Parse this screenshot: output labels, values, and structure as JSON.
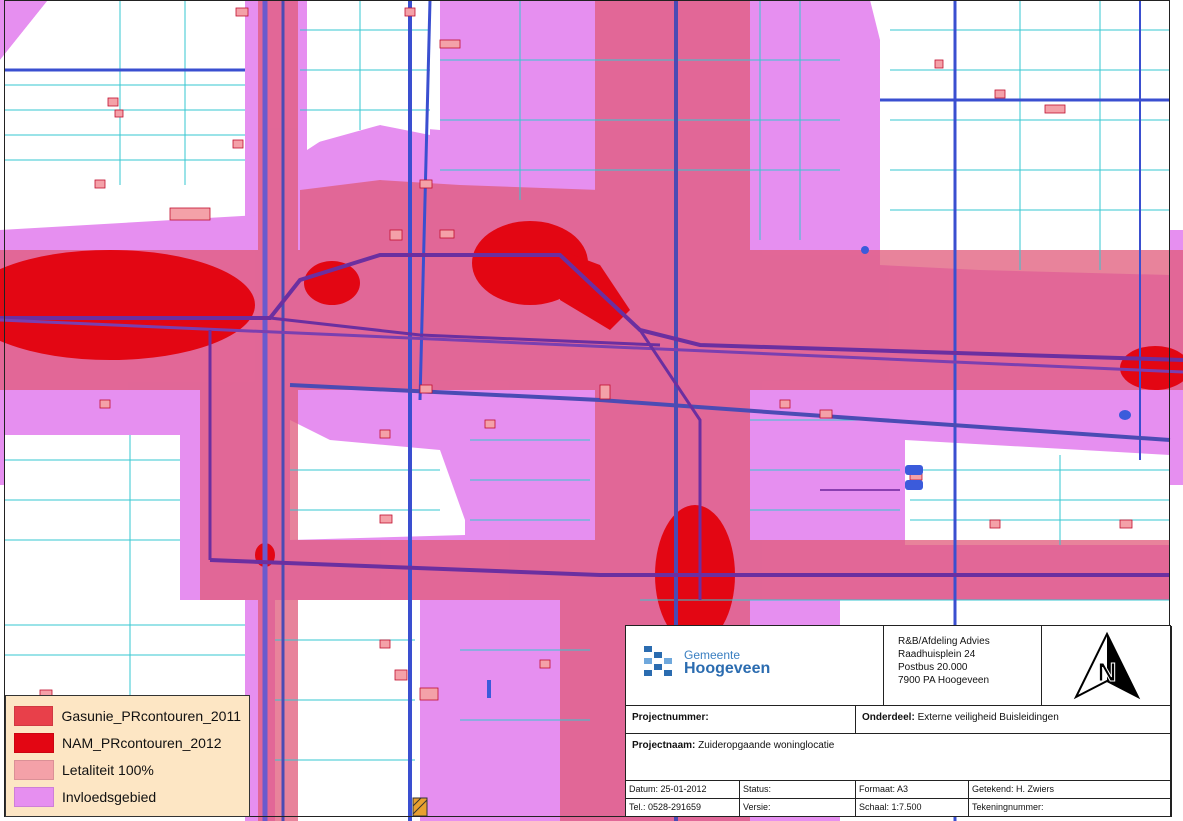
{
  "legend": {
    "items": [
      {
        "label": "Gasunie_PRcontouren_2011",
        "color": "#e8404a"
      },
      {
        "label": "NAM_PRcontouren_2012",
        "color": "#e30613"
      },
      {
        "label": "Letaliteit 100%",
        "color": "#f4a1a8"
      },
      {
        "label": "Invloedsgebied",
        "color": "#e68ff0"
      }
    ]
  },
  "titleblock": {
    "logo_top": "Gemeente",
    "logo_bottom": "Hoogeveen",
    "address": [
      "R&B/Afdeling Advies",
      "Raadhuisplein 24",
      "Postbus 20.000",
      "7900 PA  Hoogeveen"
    ],
    "projectnummer_label": "Projectnummer:",
    "onderdeel_label": "Onderdeel:",
    "onderdeel_value": "Externe veiligheid Buisleidingen",
    "projectnaam_label": "Projectnaam:",
    "projectnaam_value": "Zuideropgaande woninglocatie",
    "datum": "Datum: 25-01-2012",
    "status": "Status:",
    "formaat": "Formaat: A3",
    "getekend": "Getekend: H. Zwiers",
    "tel": "Tel.: 0528-291659",
    "versie": "Versie:",
    "schaal": "Schaal:  1:7.500",
    "tekeningnummer": "Tekeningnummer:"
  }
}
